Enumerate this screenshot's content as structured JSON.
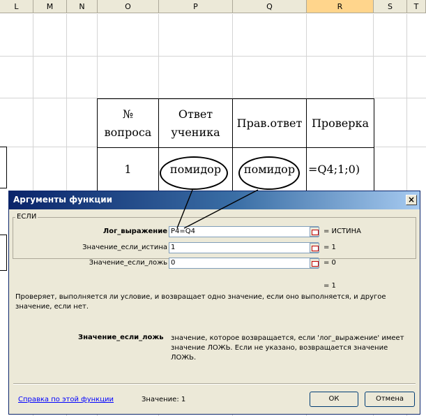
{
  "columns": [
    "L",
    "M",
    "N",
    "O",
    "P",
    "Q",
    "R",
    "S",
    "T"
  ],
  "selected_column": "R",
  "table": {
    "headers": [
      "№ вопроса",
      "Ответ ученика",
      "Прав.ответ",
      "Проверка"
    ],
    "row": [
      "1",
      "помидор",
      "помидор",
      "=Q4;1;0)"
    ]
  },
  "dialog": {
    "title": "Аргументы функции",
    "close_label": "×",
    "function_name": "ЕСЛИ",
    "args": [
      {
        "label": "Лог_выражение",
        "value": "P4=Q4",
        "result": "= ИСТИНА"
      },
      {
        "label": "Значение_если_истина",
        "value": "1",
        "result": "= 1"
      },
      {
        "label": "Значение_если_ложь",
        "value": "0",
        "result": "= 0"
      }
    ],
    "formula_result": "= 1",
    "description": "Проверяет, выполняется ли условие, и возвращает одно значение, если оно выполняется, и другое значение, если нет.",
    "detail_label": "Значение_если_ложь",
    "detail_text": "значение, которое возвращается, если 'лог_выражение' имеет значение ЛОЖЬ. Если не указано, возвращается значение ЛОЖЬ.",
    "help_link": "Справка по этой функции",
    "value_text": "Значение: 1",
    "ok_label": "ОК",
    "cancel_label": "Отмена"
  }
}
